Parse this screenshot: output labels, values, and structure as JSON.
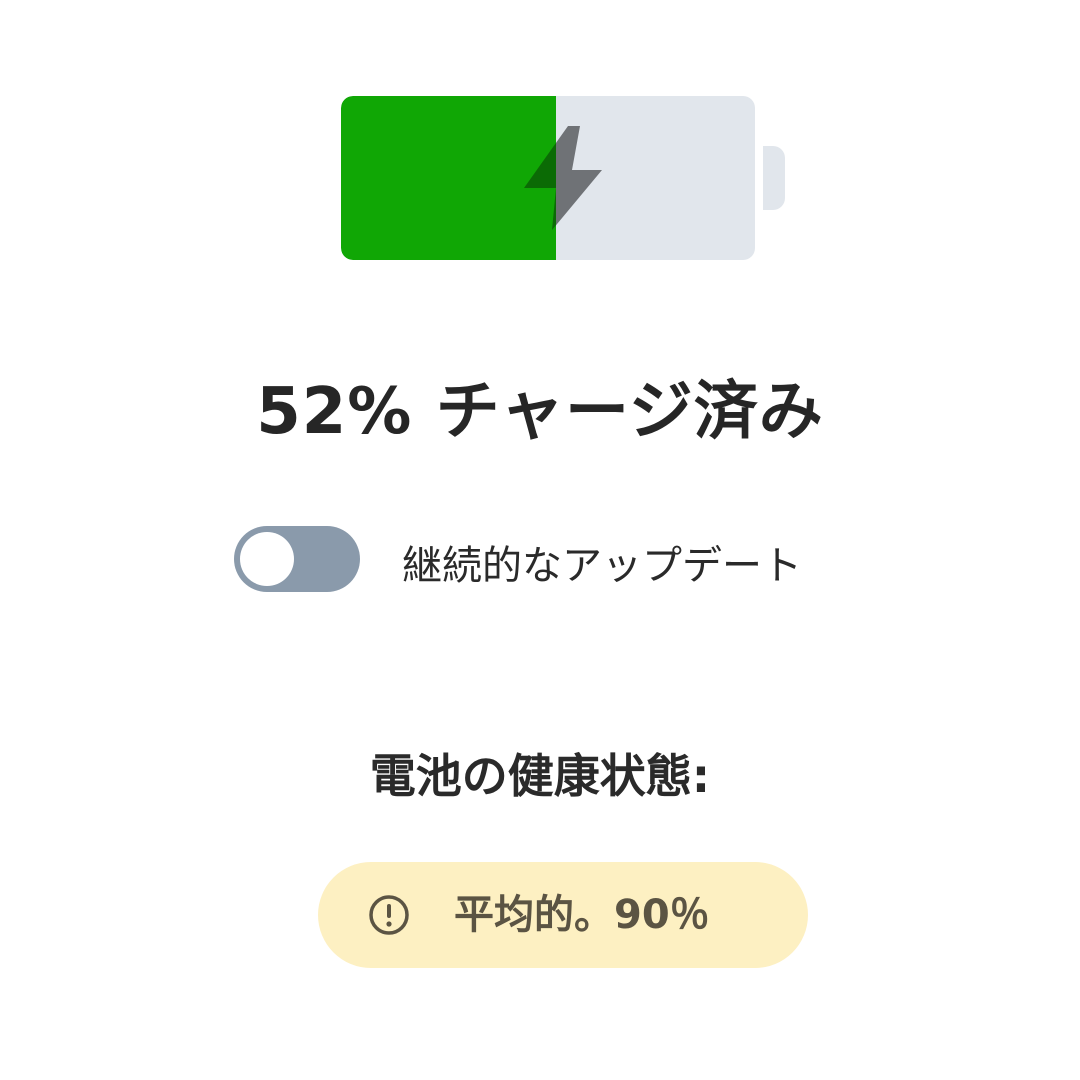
{
  "battery": {
    "charge_fraction": 0.52,
    "fill_color": "#10a705",
    "empty_color": "#e1e6ec",
    "bolt_icon": "lightning-bolt-icon"
  },
  "status": {
    "title": "52% チャージ済み"
  },
  "toggle": {
    "label": "継続的なアップデート",
    "state": "off",
    "track_color": "#8a9aab"
  },
  "health": {
    "heading": "電池の健康状態:",
    "value": "平均的。90％",
    "icon": "exclamation-circle-icon",
    "badge_color": "#fdf0c2"
  }
}
